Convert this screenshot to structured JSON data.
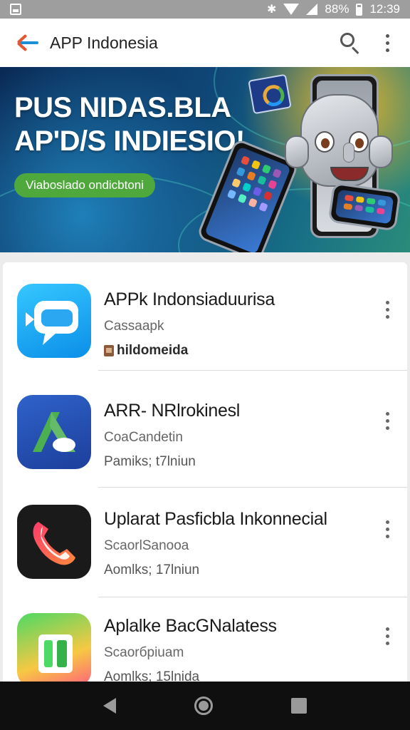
{
  "status_bar": {
    "battery": "88%",
    "time": "12:39",
    "icons": [
      "image-notification-icon",
      "bluetooth-icon",
      "wifi-icon",
      "signal-icon",
      "battery-icon"
    ]
  },
  "app_bar": {
    "title": "APP Indonesia",
    "icons": [
      "back-arrow-icon",
      "search-icon",
      "more-vert-icon"
    ],
    "accent_colors": {
      "arrow_shaft": "#1c8fd6",
      "arrow_head": "#e8542c"
    }
  },
  "banner": {
    "headline_line1": "PUS NIDAS.BLA",
    "headline_line2": "AP'D/S INDIESIO!",
    "cta_label": "Viaboslado ondicbtoni",
    "cta_color": "#4ea83b"
  },
  "app_list": [
    {
      "title": "APPk Indonsiaduurisa",
      "subtitle": "Cassaapk",
      "meta": "hildomeida",
      "meta_icon": "store-icon",
      "icon_name": "chat-bubble-app-icon"
    },
    {
      "title": "ARR- NRlrokinesl",
      "subtitle": "CoaCandetin",
      "meta": "Pamiks; t7lniun",
      "icon_name": "letter-a-app-icon"
    },
    {
      "title": "Uplarat Pasficbla Inkonnecial",
      "subtitle": "ScaorlSanooa",
      "meta": "Aomlks; 17lniun",
      "icon_name": "phone-app-icon"
    },
    {
      "title": "Aplalke BacGNalatess",
      "subtitle": "Scaorбpiuam",
      "meta": "Aomlks; 15lnida",
      "icon_name": "door-app-icon"
    }
  ],
  "nav_bar": {
    "icons": [
      "nav-back-icon",
      "nav-home-icon",
      "nav-recents-icon"
    ]
  }
}
